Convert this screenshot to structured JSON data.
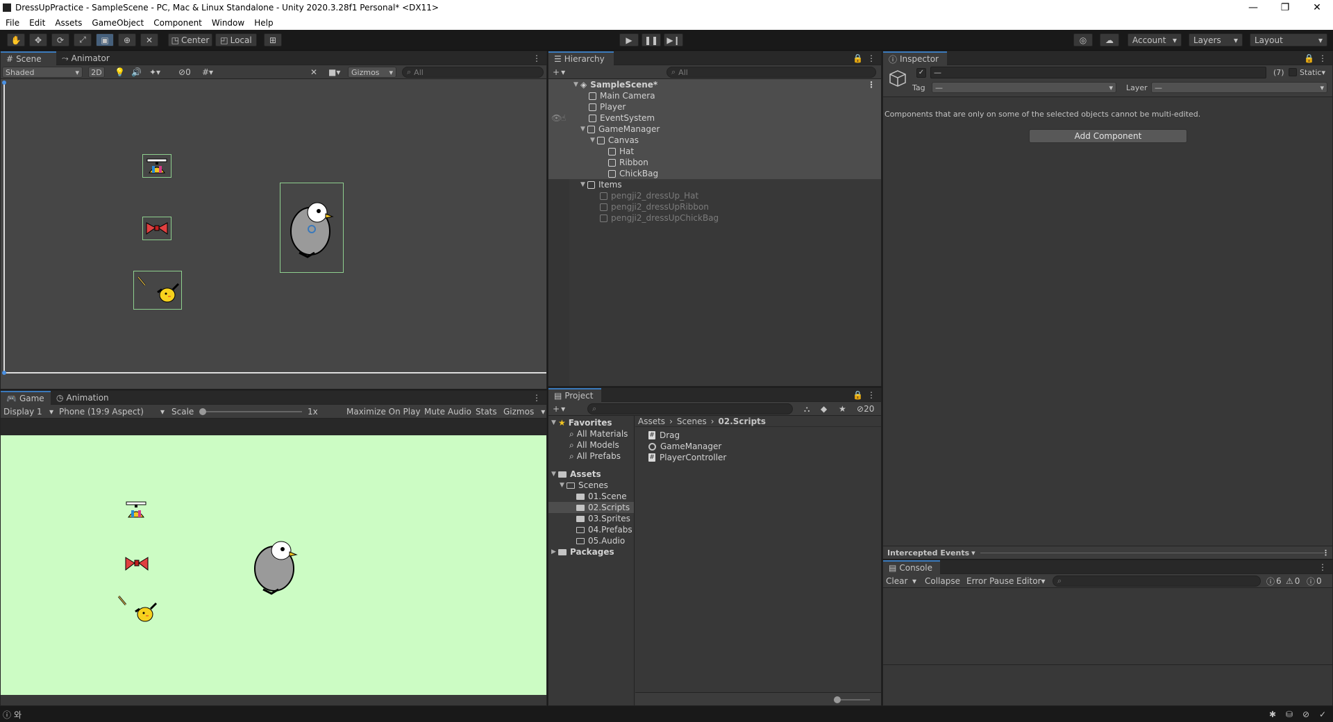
{
  "window": {
    "title": "DressUpPractice - SampleScene - PC, Mac & Linux Standalone - Unity 2020.3.28f1 Personal* <DX11>",
    "minimize": "—",
    "maximize": "❐",
    "close": "✕"
  },
  "menu": [
    "File",
    "Edit",
    "Assets",
    "GameObject",
    "Component",
    "Window",
    "Help"
  ],
  "toolbar": {
    "center": "Center",
    "local": "Local",
    "account": "Account",
    "layers": "Layers",
    "layout": "Layout"
  },
  "scene": {
    "tab_scene": "Scene",
    "tab_animator": "Animator",
    "shading": "Shaded",
    "mode2d": "2D",
    "hidden_count": "0",
    "gizmos": "Gizmos",
    "search_placeholder": "All"
  },
  "game": {
    "tab_game": "Game",
    "tab_animation": "Animation",
    "display": "Display 1",
    "aspect": "Phone (19:9 Aspect)",
    "scale_label": "Scale",
    "scale_value": "1x",
    "maximize": "Maximize On Play",
    "mute": "Mute Audio",
    "stats": "Stats",
    "gizmos": "Gizmos"
  },
  "hierarchy": {
    "tab": "Hierarchy",
    "search_placeholder": "All",
    "scene": "SampleScene*",
    "items": [
      {
        "label": "Main Camera",
        "indent": 1
      },
      {
        "label": "Player",
        "indent": 1
      },
      {
        "label": "EventSystem",
        "indent": 1
      },
      {
        "label": "GameManager",
        "indent": 1
      },
      {
        "label": "Canvas",
        "indent": 2
      },
      {
        "label": "Hat",
        "indent": 3
      },
      {
        "label": "Ribbon",
        "indent": 3
      },
      {
        "label": "ChickBag",
        "indent": 3
      },
      {
        "label": "Items",
        "indent": 1
      },
      {
        "label": "pengji2_dressUp_Hat",
        "indent": 2
      },
      {
        "label": "pengji2_dressUpRibbon",
        "indent": 2
      },
      {
        "label": "pengji2_dressUpChickBag",
        "indent": 2
      }
    ]
  },
  "project": {
    "tab": "Project",
    "badge": "20",
    "favorites": "Favorites",
    "fav_items": [
      "All Materials",
      "All Models",
      "All Prefabs"
    ],
    "assets": "Assets",
    "scenes": "Scenes",
    "folders": [
      "01.Scene",
      "02.Scripts",
      "03.Sprites",
      "04.Prefabs",
      "05.Audio"
    ],
    "packages": "Packages",
    "breadcrumb": [
      "Assets",
      "Scenes",
      "02.Scripts"
    ],
    "files": [
      "Drag",
      "GameManager",
      "PlayerController"
    ]
  },
  "inspector": {
    "tab": "Inspector",
    "name_value": "—",
    "count": "(7)",
    "static_label": "Static",
    "tag_label": "Tag",
    "tag_value": "—",
    "layer_label": "Layer",
    "layer_value": "—",
    "message": "Components that are only on some of the selected objects cannot be multi-edited.",
    "add_component": "Add Component",
    "intercepted": "Intercepted Events"
  },
  "console": {
    "tab": "Console",
    "clear": "Clear",
    "collapse": "Collapse",
    "error_pause": "Error Pause",
    "editor": "Editor",
    "log_count": "6",
    "warn_count": "0",
    "error_count": "0"
  },
  "status": {
    "text": "와"
  }
}
